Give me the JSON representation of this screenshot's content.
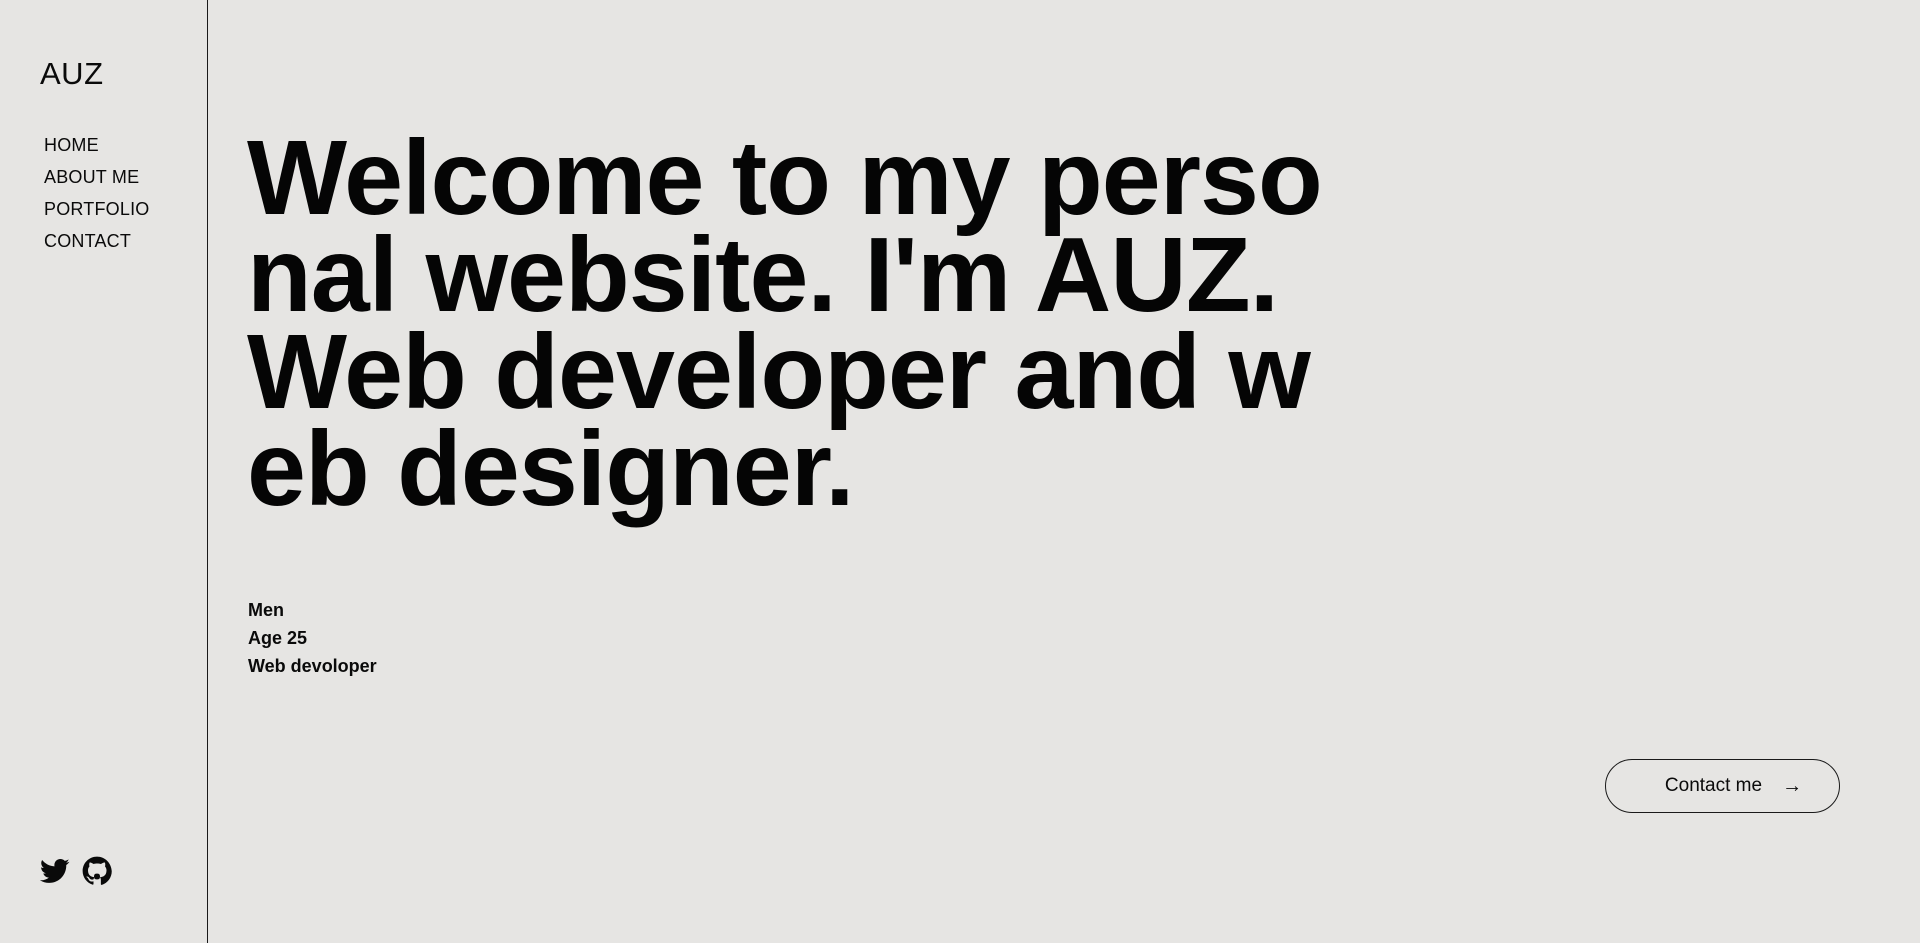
{
  "sidebar": {
    "logo": "AUZ",
    "nav": [
      {
        "label": "HOME"
      },
      {
        "label": "ABOUT ME"
      },
      {
        "label": "PORTFOLIO"
      },
      {
        "label": "CONTACT"
      }
    ],
    "socials": [
      {
        "icon": "twitter-icon"
      },
      {
        "icon": "github-icon"
      }
    ]
  },
  "hero": {
    "headline": "Welcome to my personal website. I'm AUZ. Web developer and web designer."
  },
  "info": {
    "gender": "Men",
    "age": "Age 25",
    "role": "Web devoloper"
  },
  "cta": {
    "label": "Contact me",
    "icon": "arrow-right-icon"
  },
  "colors": {
    "background": "#e6e5e3",
    "text": "#0a0a0a"
  }
}
